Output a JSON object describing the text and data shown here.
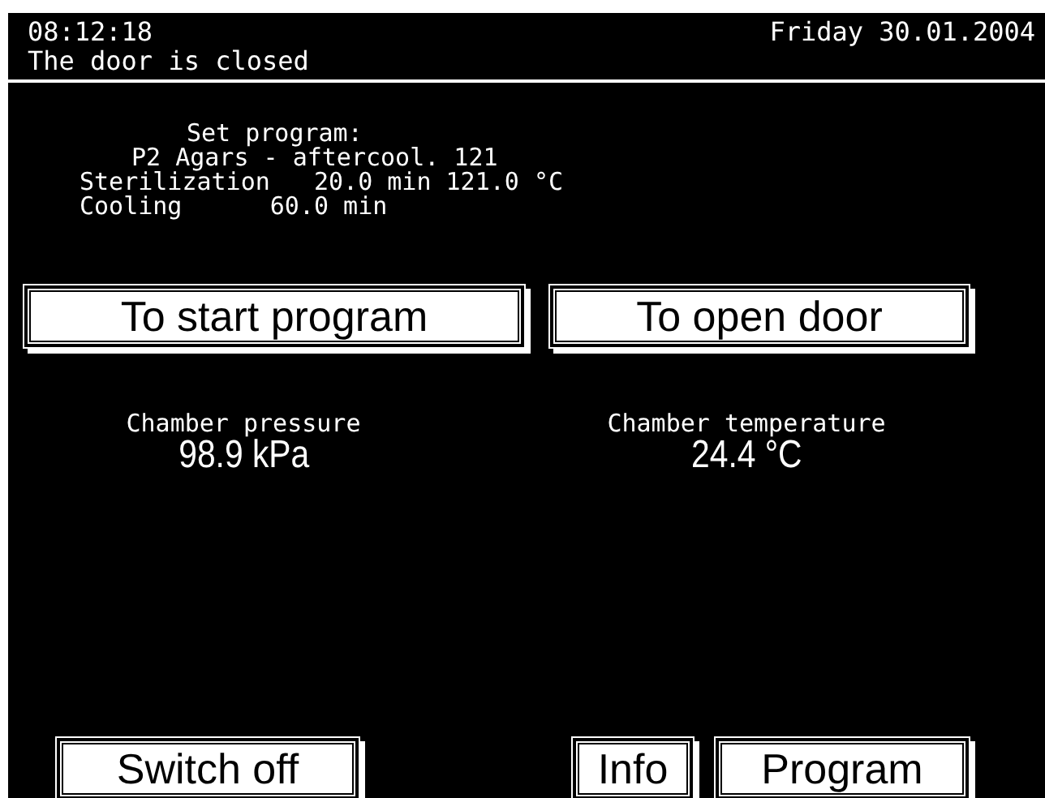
{
  "header": {
    "time": "08:12:18",
    "date": "Friday 30.01.2004",
    "status": "The door is closed"
  },
  "program": {
    "heading": "Set program:",
    "name": "P2 Agars - aftercool. 121",
    "lines": [
      "Sterilization   20.0 min 121.0 °C",
      "Cooling      60.0 min"
    ]
  },
  "actions": [
    "To start program",
    "To open door"
  ],
  "readings": [
    {
      "label": "Chamber pressure",
      "value": "98.9 kPa"
    },
    {
      "label": "Chamber temperature",
      "value": "24.4 °C"
    }
  ],
  "footer_buttons": [
    "Switch off",
    "Info",
    "Program"
  ]
}
